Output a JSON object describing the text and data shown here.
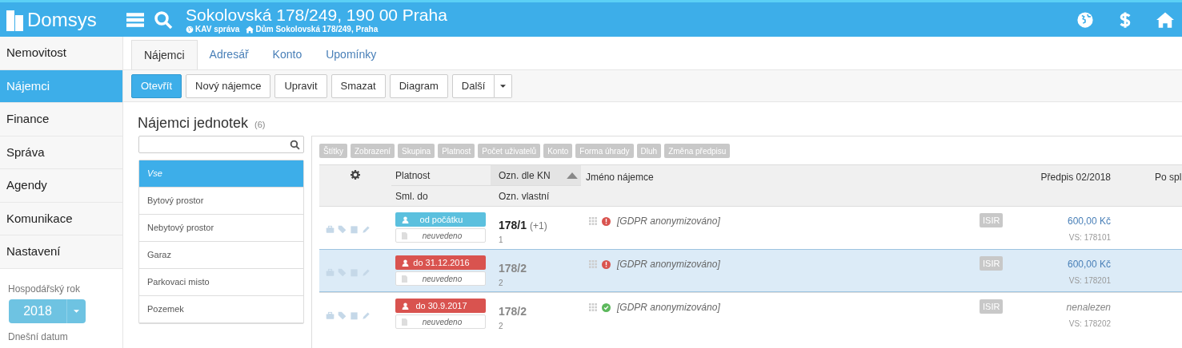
{
  "header": {
    "logo": "Domsys",
    "title": "Sokolovská 178/249, 190 00 Praha",
    "breadcrumbs": [
      {
        "kind": "globe",
        "label": "KAV správa"
      },
      {
        "kind": "home",
        "label": "Dům Sokolovská 178/249, Praha"
      }
    ]
  },
  "sidebar": {
    "items": [
      {
        "label": "Nemovitost",
        "selected": false
      },
      {
        "label": "Nájemci",
        "selected": true
      },
      {
        "label": "Finance",
        "selected": false
      },
      {
        "label": "Správa",
        "selected": false
      },
      {
        "label": "Agendy",
        "selected": false
      },
      {
        "label": "Komunikace",
        "selected": false
      },
      {
        "label": "Nastavení",
        "selected": false
      }
    ],
    "year_label": "Hospodářský rok",
    "year": "2018",
    "date_label": "Dnešní datum"
  },
  "tabs": [
    {
      "label": "Nájemci",
      "selected": true
    },
    {
      "label": "Adresář",
      "selected": false
    },
    {
      "label": "Konto",
      "selected": false
    },
    {
      "label": "Upomínky",
      "selected": false
    }
  ],
  "toolbar": [
    {
      "label": "Otevřít",
      "primary": true
    },
    {
      "label": "Nový nájemce",
      "primary": false
    },
    {
      "label": "Upravit",
      "primary": false
    },
    {
      "label": "Smazat",
      "primary": false
    },
    {
      "label": "Diagram",
      "primary": false
    },
    {
      "label": "Další",
      "primary": false,
      "dropdown": true
    }
  ],
  "section": {
    "title": "Nájemci jednotek",
    "count": "(6)"
  },
  "categories": [
    {
      "label": "Vse",
      "selected": true
    },
    {
      "label": "Bytový prostor",
      "selected": false
    },
    {
      "label": "Nebytový prostor",
      "selected": false
    },
    {
      "label": "Garaz",
      "selected": false
    },
    {
      "label": "Parkovaci misto",
      "selected": false
    },
    {
      "label": "Pozemek",
      "selected": false
    }
  ],
  "filters": [
    "Štítky",
    "Zobrazení",
    "Skupina",
    "Platnost",
    "Počet uživatelů",
    "Konto",
    "Forma úhrady",
    "Dluh",
    "Změna předpisu"
  ],
  "table": {
    "columns": {
      "platnost": "Platnost",
      "sml_do": "Sml. do",
      "ozn_kn": "Ozn. dle KN",
      "ozn_vlastni": "Ozn. vlastní",
      "jmeno": "Jméno nájemce",
      "predpis": "Předpis 02/2018",
      "po_spl": "Po spl"
    },
    "rows": [
      {
        "selected": false,
        "validity": "od počátku",
        "expired": false,
        "contract": "neuvedeno",
        "ozn_kn": "178/1",
        "ozn_extra": "(+1)",
        "ozn_kn_bold": true,
        "ozn_vlastni": "1",
        "verified": false,
        "name": "[GDPR anonymizováno]",
        "isir": "ISIR",
        "amount": "600,00 Kč",
        "amount_found": true,
        "vs": "VS: 178101"
      },
      {
        "selected": true,
        "validity": "do 31.12.2016",
        "expired": true,
        "contract": "neuvedeno",
        "ozn_kn": "178/2",
        "ozn_kn_bold": false,
        "ozn_vlastni": "2",
        "verified": false,
        "name": "[GDPR anonymizováno]",
        "isir": "ISIR",
        "amount": "600,00 Kč",
        "amount_found": true,
        "vs": "VS: 178201"
      },
      {
        "selected": false,
        "validity": "do 30.9.2017",
        "expired": true,
        "contract": "neuvedeno",
        "ozn_kn": "178/2",
        "ozn_kn_bold": false,
        "ozn_vlastni": "2",
        "verified": true,
        "name": "[GDPR anonymizováno]",
        "isir": "ISIR",
        "amount": "nenalezen",
        "amount_found": false,
        "vs": "VS: 178202"
      }
    ]
  }
}
